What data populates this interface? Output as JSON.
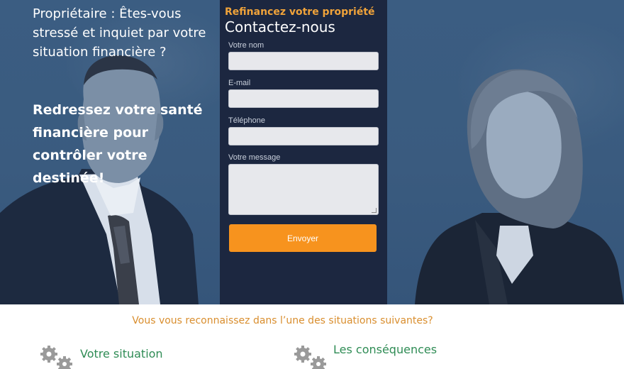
{
  "hero": {
    "intro": "Propriétaire : Êtes-vous stressé et inquiet par votre situation financière ?",
    "headline": "Redressez votre santé financière pour contrôler votre destinée!"
  },
  "form": {
    "kicker": "Refinancez votre propriété",
    "title": "Contactez-nous",
    "fields": [
      {
        "label": "Votre nom",
        "value": ""
      },
      {
        "label": "E-mail",
        "value": ""
      },
      {
        "label": "Téléphone",
        "value": ""
      },
      {
        "label": "Votre message",
        "value": ""
      }
    ],
    "submit_label": "Envoyer"
  },
  "situations": {
    "title": "Vous vous reconnaissez dans l’une des situations suivantes?",
    "columns": [
      {
        "title": "Votre situation",
        "icon": "gears-icon"
      },
      {
        "title": "Les conséquences",
        "icon": "gears-icon"
      }
    ]
  },
  "colors": {
    "hero_bg": "#3a5b7f",
    "panel_bg": "#1c2740",
    "accent_orange": "#f7931e",
    "kicker_orange": "#f0a33a",
    "green": "#2f8c55"
  }
}
